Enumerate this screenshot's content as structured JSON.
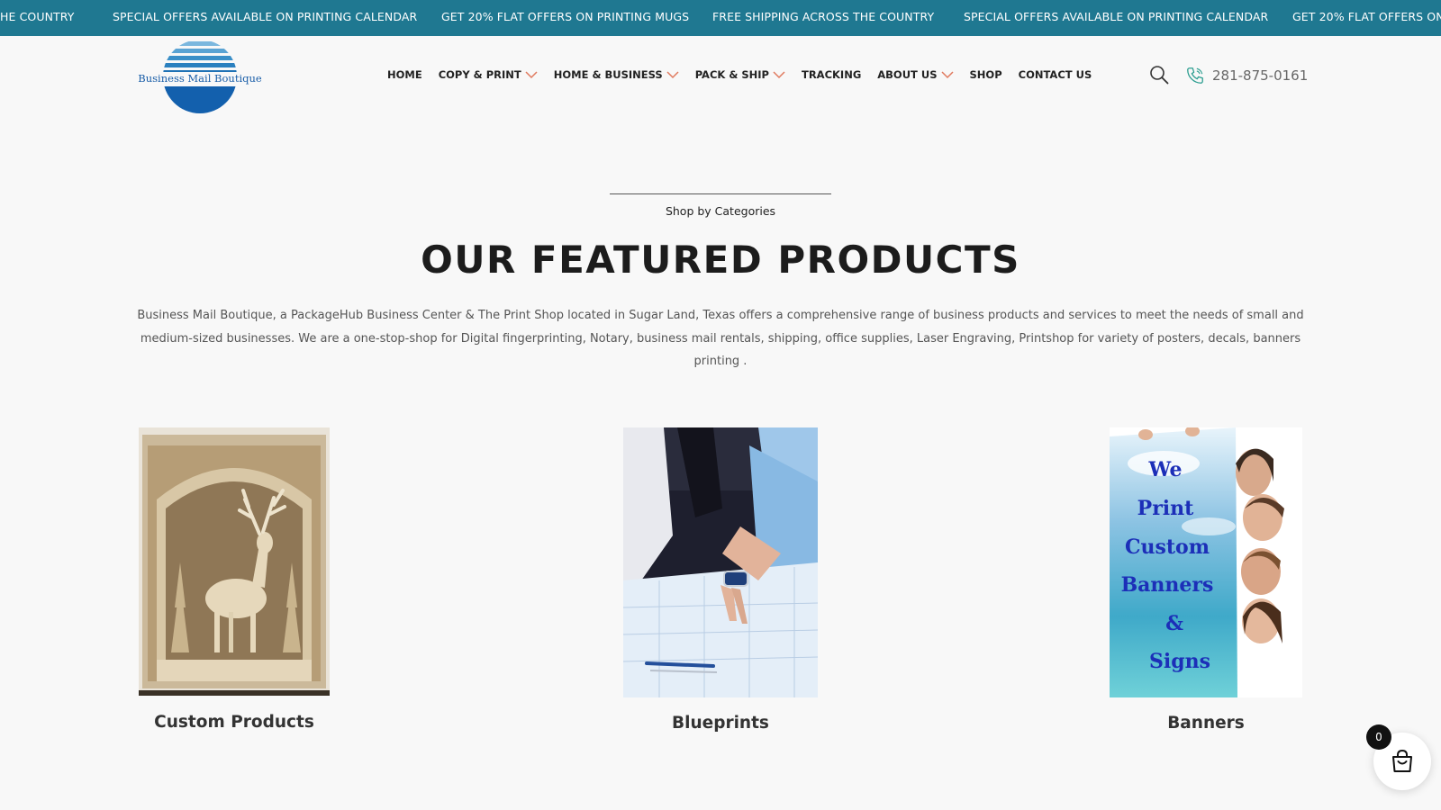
{
  "ticker": {
    "items": [
      "HE COUNTRY",
      "SPECIAL OFFERS AVAILABLE ON PRINTING CALENDAR",
      "GET 20% FLAT OFFERS ON PRINTING MUGS",
      "FREE SHIPPING ACROSS THE COUNTRY",
      "SPECIAL OFFERS AVAILABLE ON PRINTING CALENDAR",
      "GET 20% FLAT OFFERS ON P"
    ]
  },
  "header": {
    "logo_text": "Business Mail Boutique",
    "nav": [
      {
        "label": "HOME",
        "has_dropdown": false
      },
      {
        "label": "COPY & PRINT",
        "has_dropdown": true
      },
      {
        "label": "HOME & BUSINESS",
        "has_dropdown": true
      },
      {
        "label": "PACK & SHIP",
        "has_dropdown": true
      },
      {
        "label": "TRACKING",
        "has_dropdown": false
      },
      {
        "label": "ABOUT US",
        "has_dropdown": true
      },
      {
        "label": "SHOP",
        "has_dropdown": false
      },
      {
        "label": "CONTACT US",
        "has_dropdown": false
      }
    ],
    "search_icon": "search-icon",
    "phone_icon": "phone-icon",
    "phone": "281-875-0161"
  },
  "featured": {
    "eyebrow": "Shop by Categories",
    "title": "OUR FEATURED PRODUCTS",
    "intro": "Business Mail Boutique, a PackageHub Business Center & The Print Shop located in Sugar Land, Texas offers a comprehensive range of business products and services to meet the needs of small and medium-sized businesses. We are a one-stop-shop for Digital fingerprinting, Notary, business mail rentals, shipping, office supplies, Laser Engraving, Printshop for variety of posters, decals, banners printing .",
    "products": [
      {
        "name": "Custom Products"
      },
      {
        "name": "Blueprints"
      },
      {
        "name": "Banners",
        "image_text": [
          "We",
          "Print",
          "Custom",
          "Banners",
          "&",
          "Signs"
        ]
      }
    ]
  },
  "cart": {
    "count": "0",
    "icon": "shopping-bag-icon"
  },
  "colors": {
    "ticker_bg": "#1f7891",
    "accent_chevron": "#e07a5f",
    "logo_blue": "#1a5ea8",
    "page_bg": "#f8f8f8"
  }
}
